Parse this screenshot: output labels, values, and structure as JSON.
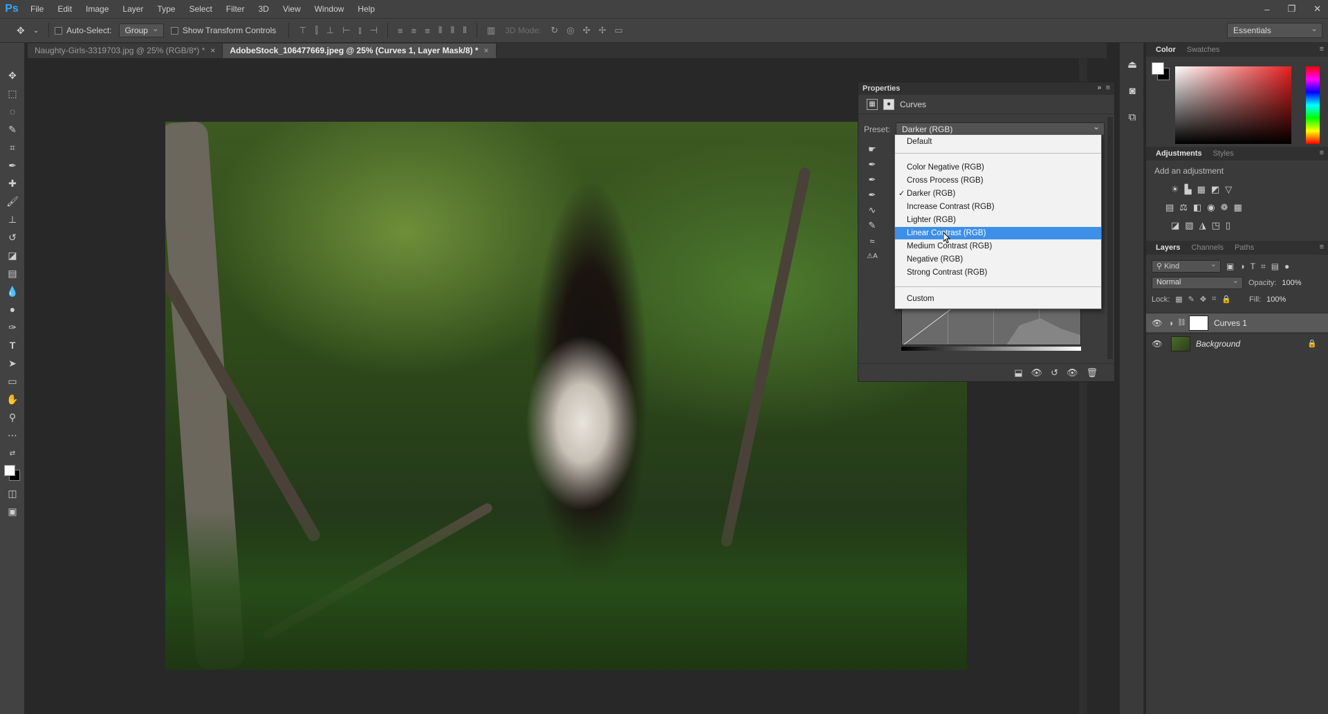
{
  "app": {
    "logo": "Ps"
  },
  "menu": [
    "File",
    "Edit",
    "Image",
    "Layer",
    "Type",
    "Select",
    "Filter",
    "3D",
    "View",
    "Window",
    "Help"
  ],
  "window_controls": {
    "minimize": "–",
    "restore": "❐",
    "close": "✕"
  },
  "options": {
    "auto_select_label": "Auto-Select:",
    "auto_select_value": "Group",
    "transform_label": "Show Transform Controls",
    "mode_label": "3D Mode:",
    "workspace": "Essentials"
  },
  "tabs": [
    {
      "label": "Naughty-Girls-3319703.jpg @ 25% (RGB/8*) *",
      "close": "×"
    },
    {
      "label": "AdobeStock_106477669.jpeg @ 25% (Curves 1, Layer Mask/8) *",
      "close": "×"
    }
  ],
  "properties": {
    "title": "Properties",
    "subtitle": "Curves",
    "preset_label": "Preset:",
    "preset_value": "Darker (RGB)"
  },
  "preset_menu": {
    "items": [
      "Default",
      "Color Negative (RGB)",
      "Cross Process (RGB)",
      "Darker (RGB)",
      "Increase Contrast (RGB)",
      "Lighter (RGB)",
      "Linear Contrast (RGB)",
      "Medium Contrast (RGB)",
      "Negative (RGB)",
      "Strong Contrast (RGB)",
      "Custom"
    ],
    "checked": "Darker (RGB)",
    "highlighted": "Linear Contrast (RGB)",
    "check_glyph": "✓"
  },
  "color_panel": {
    "tabs": [
      "Color",
      "Swatches"
    ],
    "accent": "#e62020"
  },
  "adjustments_panel": {
    "tabs": [
      "Adjustments",
      "Styles"
    ],
    "title": "Add an adjustment"
  },
  "layers_panel": {
    "tabs": [
      "Layers",
      "Channels",
      "Paths"
    ],
    "kind_label": "Kind",
    "blend_mode": "Normal",
    "opacity_label": "Opacity:",
    "opacity_value": "100%",
    "lock_label": "Lock:",
    "fill_label": "Fill:",
    "fill_value": "100%",
    "layers": [
      {
        "name": "Curves 1",
        "selected": true
      },
      {
        "name": "Background",
        "selected": false
      }
    ]
  }
}
